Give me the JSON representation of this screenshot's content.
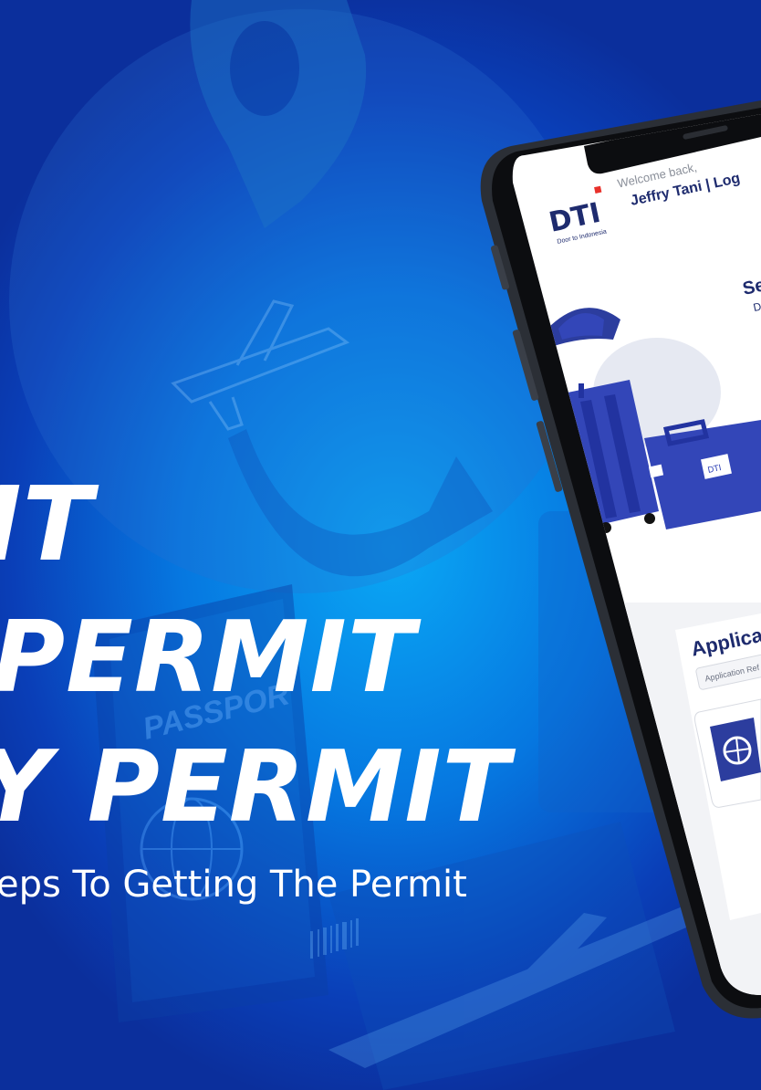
{
  "banner": {
    "headline_1": "IT",
    "headline_2": "PERMIT",
    "headline_3": "Y PERMIT",
    "subheadline": "eps To Getting The Permit"
  },
  "background": {
    "passport_label": "PASSPOR"
  },
  "phone_screen": {
    "logo_text": "DTI",
    "logo_tagline": "Door to Indonesia",
    "welcome_text": "Welcome back,",
    "user_line": "Jeffry Tani | Log",
    "search_partial_title": "Se",
    "search_partial_sub": "D",
    "application_title": "Applica",
    "application_ref_label": "Application Ref"
  },
  "colors": {
    "bg_light": "#0aa8f5",
    "bg_dark": "#0b2f9c",
    "brand_navy": "#1e2b6e",
    "brand_red": "#e8312b",
    "luggage_blue": "#3346b8"
  }
}
